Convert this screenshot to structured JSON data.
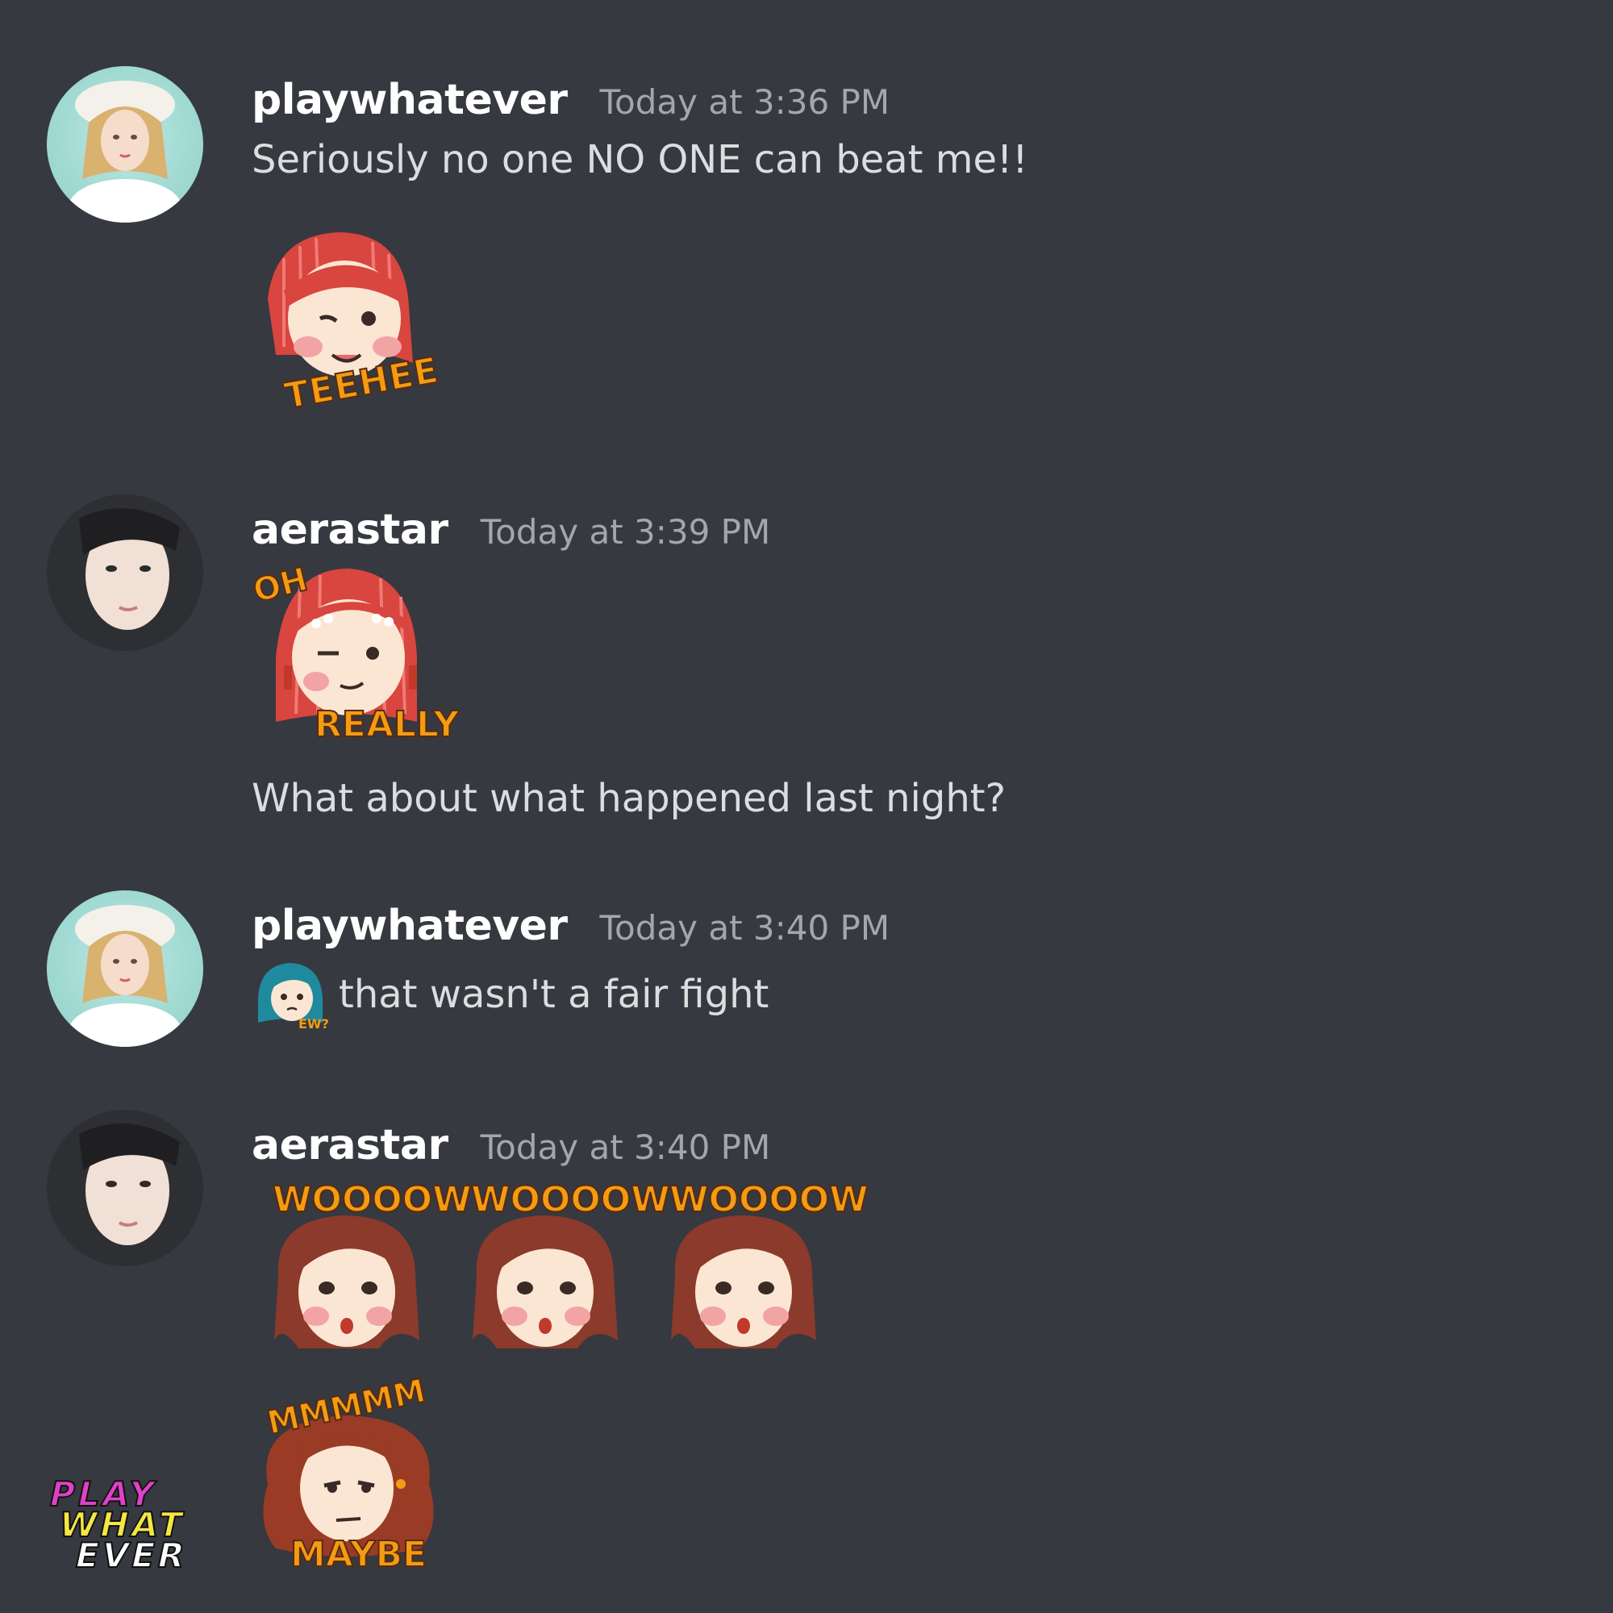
{
  "messages": [
    {
      "username": "playwhatever",
      "timestamp": "Today at 3:36 PM",
      "text": "Seriously no one NO ONE can beat me!!",
      "avatar_icon": "blonde-girl-avatar",
      "stickers": [
        {
          "icon": "teehee-sticker",
          "caption": "TEEHEE"
        }
      ]
    },
    {
      "username": "aerastar",
      "timestamp": "Today at 3:39 PM",
      "text": "What about what happened last night?",
      "avatar_icon": "dark-hair-girl-avatar",
      "stickers": [
        {
          "icon": "oh-really-sticker",
          "caption_top": "OH",
          "caption_bottom": "REALLY"
        }
      ]
    },
    {
      "username": "playwhatever",
      "timestamp": "Today at 3:40 PM",
      "text": "that wasn't a fair fight",
      "avatar_icon": "blonde-girl-avatar",
      "inline_emoji": {
        "icon": "ew-emoji",
        "caption": "EW?"
      }
    },
    {
      "username": "aerastar",
      "timestamp": "Today at 3:40 PM",
      "avatar_icon": "dark-hair-girl-avatar",
      "stickers": [
        {
          "icon": "wooow-sticker",
          "caption": "WOOOOW"
        },
        {
          "icon": "wooow-sticker",
          "caption": "WOOOOW"
        },
        {
          "icon": "wooow-sticker",
          "caption": "WOOOOW"
        },
        {
          "icon": "mmmm-maybe-sticker",
          "caption_top": "MMMMM",
          "caption_bottom": "MAYBE"
        }
      ]
    }
  ],
  "logo": {
    "icon": "play-what-ever-logo",
    "lines": [
      "PLAY",
      "WHAT",
      "EVER"
    ]
  },
  "colors": {
    "background": "#36393f",
    "username": "#ffffff",
    "timestamp": "#a3a6aa",
    "text": "#dcddde",
    "sticker_caption": "#f39c12"
  }
}
